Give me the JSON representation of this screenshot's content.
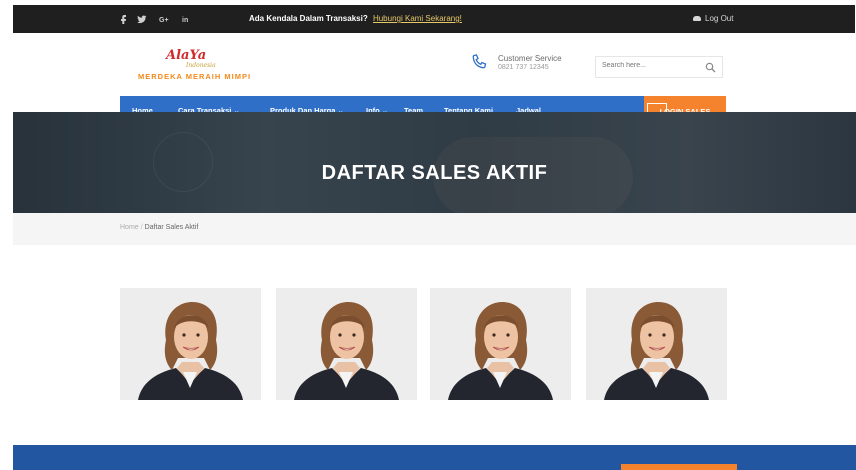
{
  "topbar": {
    "social_icons": [
      "facebook-icon",
      "twitter-icon",
      "google-plus-icon",
      "linkedin-icon"
    ],
    "promo_text": "Ada Kendala Dalam Transaksi?",
    "promo_link": "Hubungi Kami Sekarang!",
    "login_label": "Log Out"
  },
  "header": {
    "logo_top": "AlaYa",
    "logo_script": "Indonesia",
    "logo_bottom": "MERDEKA MERAIH MIMPI",
    "cs_title": "Customer Service",
    "cs_phone": "0821 737 12345",
    "search_placeholder": "Search here..."
  },
  "nav": {
    "items": [
      {
        "label": "Home",
        "caret": ""
      },
      {
        "label": "Cara Transaksi",
        "caret": "⌄"
      },
      {
        "label": "Produk Dan Harga",
        "caret": "⌄"
      },
      {
        "label": "Info",
        "caret": "⌄"
      },
      {
        "label": "Team",
        "caret": ""
      },
      {
        "label": "Tentang Kami",
        "caret": ""
      },
      {
        "label": "Jadwal",
        "caret": ""
      }
    ],
    "login_sales": "LOGIN SALES"
  },
  "hero": {
    "title": "DAFTAR SALES AKTIF"
  },
  "breadcrumb": {
    "home": "Home",
    "separator": "/",
    "current": "Daftar Sales Aktif"
  },
  "sales_cards": [
    {
      "photo": "sales-photo"
    },
    {
      "photo": "sales-photo"
    },
    {
      "photo": "sales-photo"
    },
    {
      "photo": "sales-photo"
    }
  ],
  "colors": {
    "topbar": "#1f1f1f",
    "nav": "#2f6fc7",
    "accent_orange": "#f5832d",
    "footer": "#2356a0",
    "logo_red": "#d02a2a"
  }
}
